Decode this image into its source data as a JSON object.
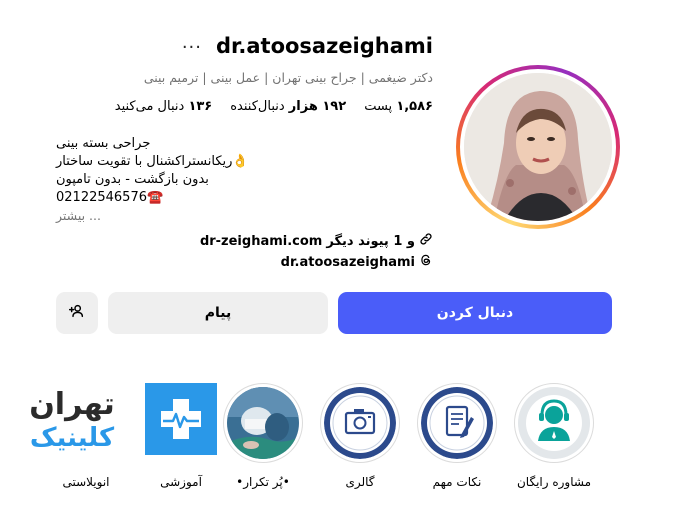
{
  "profile": {
    "username": "dr.atoosazeighami",
    "more_label": "...",
    "category": "دکتر ضیغمی | جراح بینی تهران | عمل بینی | ترمیم بینی",
    "stats": {
      "posts_num": "۱,۵۸۶",
      "posts_label": "پست",
      "followers_num": "۱۹۲ هزار",
      "followers_label": "دنبال‌کننده",
      "following_num": "۱۳۶",
      "following_label": "دنبال می‌کنید"
    },
    "bio_lines": [
      "جراحی بسته بینی",
      "ریکانستراکشنال با تقویت ساختار👌",
      "بدون بازگشت - بدون تامپون",
      "02122546576☎️"
    ],
    "bio_more": "بیشتر ...",
    "link_text": "dr-zeighami.com",
    "link_extra": "و 1 پیوند دیگر",
    "threads_handle": "dr.atoosazeighami"
  },
  "buttons": {
    "follow": "دنبال کردن",
    "message": "پیام"
  },
  "highlights": [
    {
      "label": "مشاوره رایگان",
      "icon": "headset-consultant-icon"
    },
    {
      "label": "نکات مهم",
      "icon": "document-pen-icon"
    },
    {
      "label": "گالری",
      "icon": "photo-gallery-icon"
    },
    {
      "label": "•پُر تکرار•",
      "icon": "surgery-photo"
    },
    {
      "label": "آموزشی",
      "icon": "medical-cross-pulse-icon"
    },
    {
      "label": "انویلاستی",
      "icon": "tehran-clinic-logo"
    }
  ],
  "logo": {
    "line1": "تهران",
    "line2": "کلینیک"
  },
  "colors": {
    "follow_button": "#4a5df9",
    "secondary_button": "#efefef",
    "highlight_blue_ring": "#2c4a8c",
    "consult_teal": "#0aa39a",
    "logo_blue": "#2a98e8"
  }
}
